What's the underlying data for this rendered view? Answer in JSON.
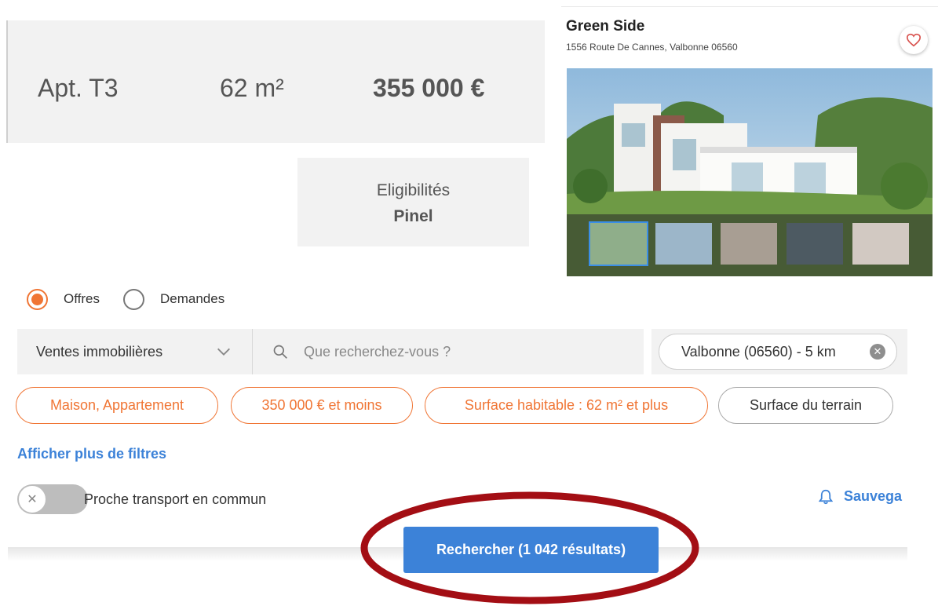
{
  "listing": {
    "type": "Apt. T3",
    "surface": "62 m²",
    "price": "355 000 €",
    "eligibility_title": "Eligibilités",
    "eligibility_value": "Pinel"
  },
  "property": {
    "name": "Green Side",
    "address": "1556 Route De Cannes, Valbonne 06560",
    "favorite_icon": "heart-icon",
    "thumbnail_count": 5,
    "active_thumbnail": 1
  },
  "offer_type": {
    "options": [
      {
        "label": "Offres",
        "checked": true
      },
      {
        "label": "Demandes",
        "checked": false
      }
    ]
  },
  "search": {
    "category": "Ventes immobilières",
    "placeholder": "Que recherchez-vous ?",
    "location": "Valbonne (06560) - 5 km"
  },
  "filters": [
    {
      "label": "Maison, Appartement",
      "active": true
    },
    {
      "label": "350 000 € et moins",
      "active": true
    },
    {
      "label": "Surface habitable : 62 m² et plus",
      "active": true
    },
    {
      "label": "Surface du terrain",
      "active": false
    }
  ],
  "more_filters_label": "Afficher plus de filtres",
  "transport_toggle": {
    "label": "Proche transport en commun",
    "on": false
  },
  "save_search_label": "Sauvega",
  "search_button_label": "Rechercher (1 042 résultats)",
  "colors": {
    "accent": "#f07534",
    "link": "#3c82d8",
    "annotation": "#a30e14"
  }
}
